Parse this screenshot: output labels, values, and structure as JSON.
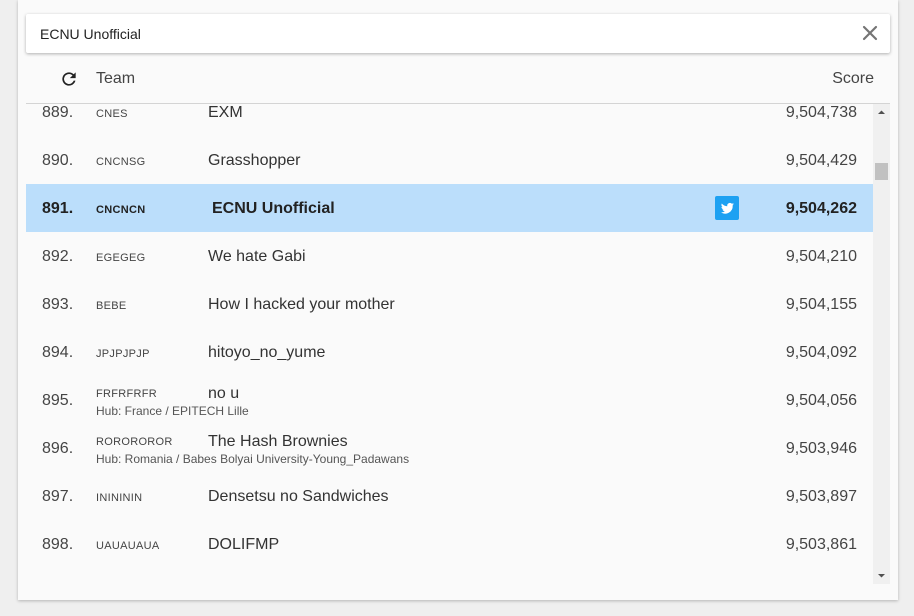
{
  "search": {
    "value": "ECNU Unofficial"
  },
  "header": {
    "team_label": "Team",
    "score_label": "Score"
  },
  "rows": [
    {
      "rank": "889.",
      "flags": "CNES",
      "name": "EXM",
      "hub": "",
      "score": "9,504,738"
    },
    {
      "rank": "890.",
      "flags": "CNCNSG",
      "name": "Grasshopper",
      "hub": "",
      "score": "9,504,429"
    },
    {
      "rank": "891.",
      "flags": "CNCNCN",
      "name": "ECNU Unofficial",
      "hub": "",
      "score": "9,504,262"
    },
    {
      "rank": "892.",
      "flags": "EGEGEG",
      "name": "We hate Gabi",
      "hub": "",
      "score": "9,504,210"
    },
    {
      "rank": "893.",
      "flags": "BEBE",
      "name": "How I hacked your mother",
      "hub": "",
      "score": "9,504,155"
    },
    {
      "rank": "894.",
      "flags": "JPJPJPJP",
      "name": "hitoyo_no_yume",
      "hub": "",
      "score": "9,504,092"
    },
    {
      "rank": "895.",
      "flags": "FRFRFRFR",
      "name": "no u",
      "hub": "Hub: France / EPITECH Lille",
      "score": "9,504,056"
    },
    {
      "rank": "896.",
      "flags": "ROROROROR",
      "name": "The Hash Brownies",
      "hub": "Hub: Romania / Babes Bolyai University-Young_Padawans",
      "score": "9,503,946"
    },
    {
      "rank": "897.",
      "flags": "ININININ",
      "name": "Densetsu no Sandwiches",
      "hub": "",
      "score": "9,503,897"
    },
    {
      "rank": "898.",
      "flags": "UAUAUAUA",
      "name": "DOLIFMP",
      "hub": "",
      "score": "9,503,861"
    }
  ],
  "colors": {
    "highlight": "#bbdefb",
    "twitter": "#1da1f2"
  },
  "icons": {
    "close": "close-icon",
    "refresh": "refresh-icon",
    "twitter": "twitter-icon"
  }
}
